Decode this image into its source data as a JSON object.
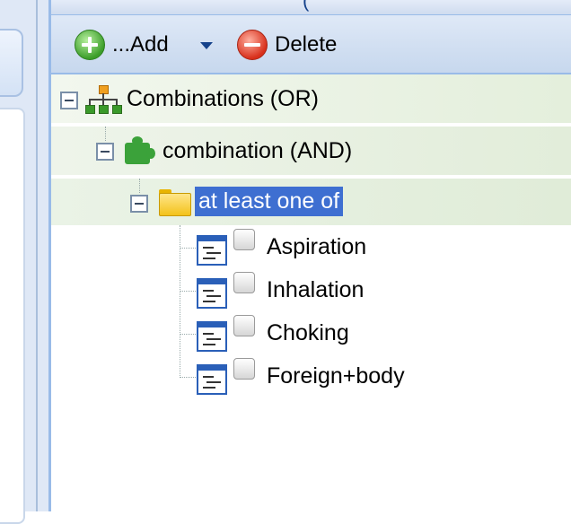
{
  "header": {
    "title_fragment": "("
  },
  "toolbar": {
    "add_label": "...Add",
    "delete_label": "Delete"
  },
  "tree": {
    "root": {
      "label": "Combinations (OR)"
    },
    "combination": {
      "label": "combination (AND)"
    },
    "group": {
      "label": "at least one of"
    },
    "items": [
      {
        "label": "Aspiration",
        "checked": false
      },
      {
        "label": "Inhalation",
        "checked": false
      },
      {
        "label": "Choking",
        "checked": false
      },
      {
        "label": "Foreign+body",
        "checked": false
      }
    ]
  },
  "colors": {
    "selection": "#3e6fd1",
    "toolbar_border": "#99bbe8",
    "node_bg": "#e4efdc"
  }
}
